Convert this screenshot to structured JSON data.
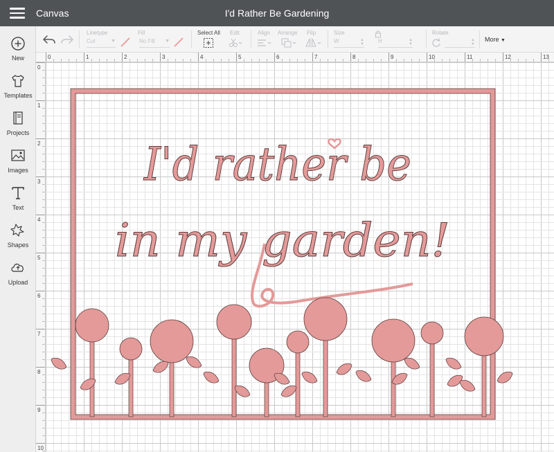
{
  "header": {
    "app_name": "Canvas",
    "project_title": "I'd Rather Be Gardening"
  },
  "sidebar": {
    "items": [
      {
        "label": "New",
        "icon": "plus-circle-icon"
      },
      {
        "label": "Templates",
        "icon": "tshirt-icon"
      },
      {
        "label": "Projects",
        "icon": "notebook-icon"
      },
      {
        "label": "Images",
        "icon": "image-icon"
      },
      {
        "label": "Text",
        "icon": "text-t-icon"
      },
      {
        "label": "Shapes",
        "icon": "shapes-icon"
      },
      {
        "label": "Upload",
        "icon": "cloud-upload-icon"
      }
    ]
  },
  "toolbar": {
    "linetype_label": "Linetype",
    "linetype_value": "Cut",
    "fill_label": "Fill",
    "fill_value": "No Fill",
    "select_all_label": "Select All",
    "edit_label": "Edit",
    "align_label": "Align",
    "arrange_label": "Arrange",
    "flip_label": "Flip",
    "size_label": "Size",
    "width_placeholder": "W",
    "height_placeholder": "H",
    "rotate_label": "Rotate",
    "more_label": "More"
  },
  "ruler": {
    "top_ticks": [
      "0",
      "1",
      "2",
      "3",
      "4",
      "5",
      "6",
      "7",
      "8",
      "9",
      "10",
      "11",
      "12",
      "13"
    ],
    "left_ticks": [
      "0",
      "1",
      "2",
      "3",
      "4",
      "5",
      "6",
      "7",
      "8",
      "9",
      "10"
    ]
  },
  "design": {
    "line1": "I'd rather be",
    "line2": "in my garden!",
    "color": "#e39a99",
    "outline_color": "#5a3c3c"
  },
  "colors": {
    "header_bg": "#505356",
    "sidebar_bg": "#eeeeef",
    "toolbar_bg": "#f4f4f5",
    "grid_minor": "#e4e4e4",
    "grid_major": "#c8c8c8"
  }
}
